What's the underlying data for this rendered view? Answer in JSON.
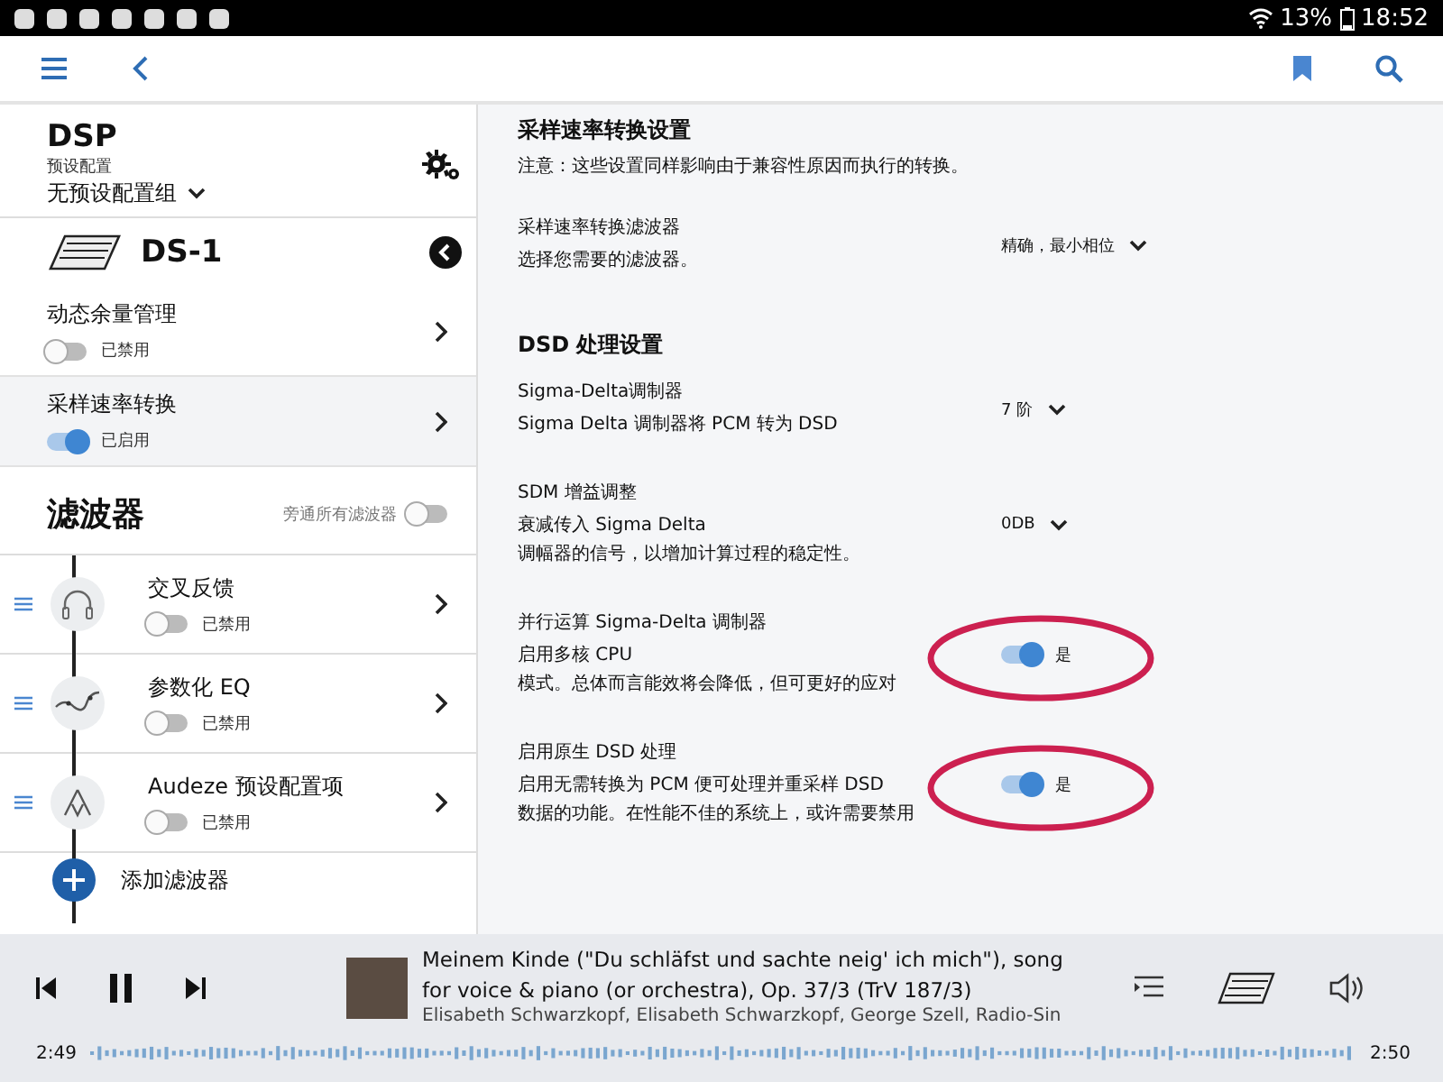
{
  "status_bar": {
    "battery": "13%",
    "time": "18:52"
  },
  "dsp": {
    "title": "DSP",
    "preset_label": "预设配置",
    "preset_value": "无预设配置组"
  },
  "device": {
    "name": "DS-1"
  },
  "modules": [
    {
      "name": "动态余量管理",
      "state": "已禁用",
      "on": false,
      "selected": false
    },
    {
      "name": "采样速率转换",
      "state": "已启用",
      "on": true,
      "selected": true
    }
  ],
  "filters": {
    "title": "滤波器",
    "bypass_label": "旁通所有滤波器",
    "bypass_on": false,
    "items": [
      {
        "kind": "headphones",
        "name": "交叉反馈",
        "state": "已禁用",
        "on": false
      },
      {
        "kind": "eq",
        "name": "参数化 EQ",
        "state": "已禁用",
        "on": false
      },
      {
        "kind": "preset",
        "name": "Audeze 预设配置项",
        "state": "已禁用",
        "on": false
      }
    ],
    "add_label": "添加滤波器"
  },
  "settings": [
    {
      "title": "采样速率转换设置",
      "note": "注意：这些设置同样影响由于兼容性原因而执行的转换。",
      "items": [
        {
          "kind": "dropdown",
          "label": "采样速率转换滤波器",
          "description": "选择您需要的滤波器。",
          "value": "精确，最小相位",
          "circled": false
        }
      ]
    },
    {
      "title": "DSD 处理设置",
      "items": [
        {
          "kind": "dropdown",
          "label": "Sigma-Delta调制器",
          "description": "Sigma Delta 调制器将 PCM 转为 DSD",
          "value": "7 阶",
          "circled": false
        },
        {
          "kind": "dropdown",
          "label": "SDM 增益调整",
          "description": "衰减传入 Sigma Delta\n调幅器的信号，以增加计算过程的稳定性。",
          "value": "0DB",
          "circled": false
        },
        {
          "kind": "toggle",
          "label": "并行运算 Sigma-Delta 调制器",
          "description": "启用多核 CPU\n模式。总体而言能效将会降低，但可更好的应对",
          "value": "是",
          "on": true,
          "circled": true
        },
        {
          "kind": "toggle",
          "label": "启用原生 DSD 处理",
          "description": "启用无需转换为 PCM 便可处理并重采样 DSD\n数据的功能。在性能不佳的系统上，或许需要禁用",
          "value": "是",
          "on": true,
          "circled": true
        }
      ]
    }
  ],
  "player": {
    "track_title": "Meinem Kinde (\"Du schläfst und sachte neig' ich mich\"), song for voice & piano (or orchestra), Op. 37/3 (TrV 187/3)",
    "artists": "Elisabeth Schwarzkopf, Elisabeth Schwarzkopf, George Szell, Radio-Sin",
    "elapsed": "2:49",
    "remaining": "2:50"
  }
}
